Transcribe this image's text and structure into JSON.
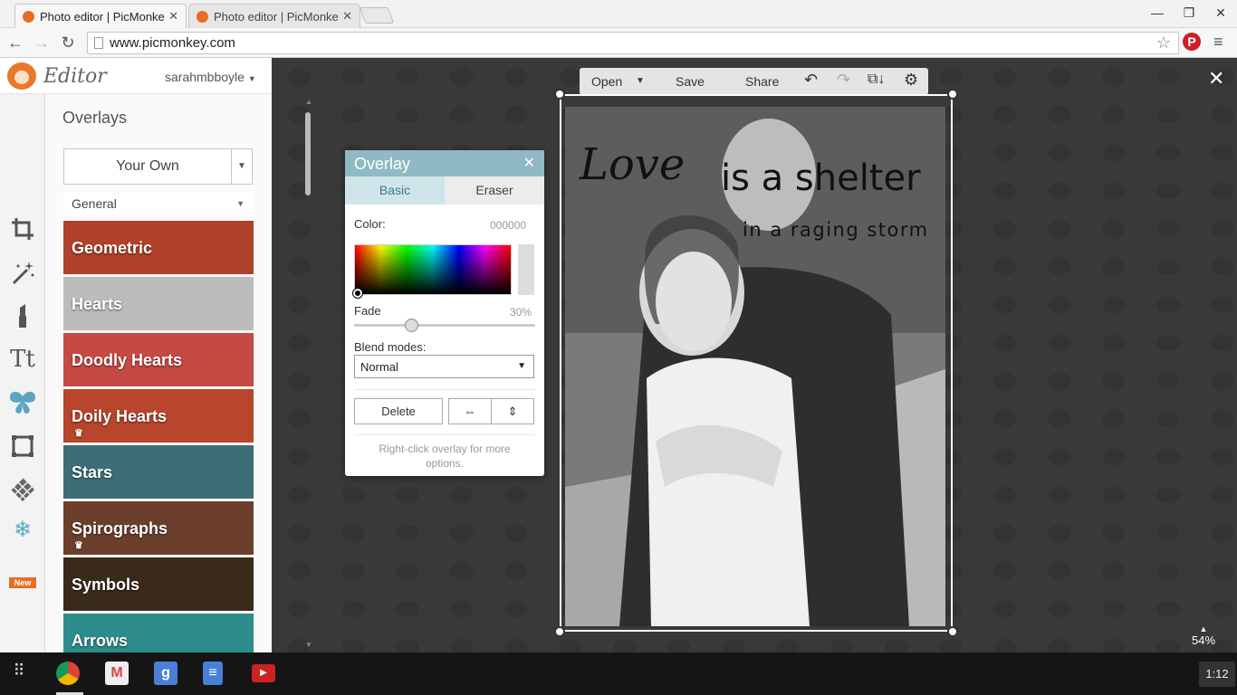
{
  "browser": {
    "tabs": [
      {
        "title": "Photo editor | PicMonkey:",
        "active": true
      },
      {
        "title": "Photo editor | PicMonkey:",
        "active": false
      }
    ],
    "url": "www.picmonkey.com"
  },
  "app": {
    "logo": "Editor",
    "user": "sarahmbboyle",
    "panel_title": "Overlays",
    "your_own_label": "Your Own",
    "category_filter": "General",
    "categories": [
      {
        "label": "Geometric",
        "color": "#b0412a",
        "crown": false
      },
      {
        "label": "Hearts",
        "color": "#bcbcbc",
        "crown": false
      },
      {
        "label": "Doodly Hearts",
        "color": "#c64a44",
        "crown": false
      },
      {
        "label": "Doily Hearts",
        "color": "#b8452c",
        "crown": true
      },
      {
        "label": "Stars",
        "color": "#3e6e75",
        "crown": false
      },
      {
        "label": "Spirographs",
        "color": "#6b3f2c",
        "crown": true
      },
      {
        "label": "Symbols",
        "color": "#3a2a1a",
        "crown": false
      },
      {
        "label": "Arrows",
        "color": "#2d8c8c",
        "crown": false
      }
    ],
    "toolbar": {
      "open": "Open",
      "save": "Save",
      "share": "Share"
    },
    "zoom": "54%",
    "accent": "#5ba6bf"
  },
  "photo_text": {
    "line1": "Love",
    "line2": "is a shelter",
    "line3": "in a raging storm"
  },
  "overlay_dialog": {
    "title": "Overlay",
    "tab_basic": "Basic",
    "tab_eraser": "Eraser",
    "color_label": "Color:",
    "color_value": "000000",
    "fade_label": "Fade",
    "fade_value": "30%",
    "blend_label": "Blend modes:",
    "blend_value": "Normal",
    "delete_label": "Delete",
    "hint": "Right-click overlay for more options."
  },
  "taskbar": {
    "time": "1:12"
  }
}
